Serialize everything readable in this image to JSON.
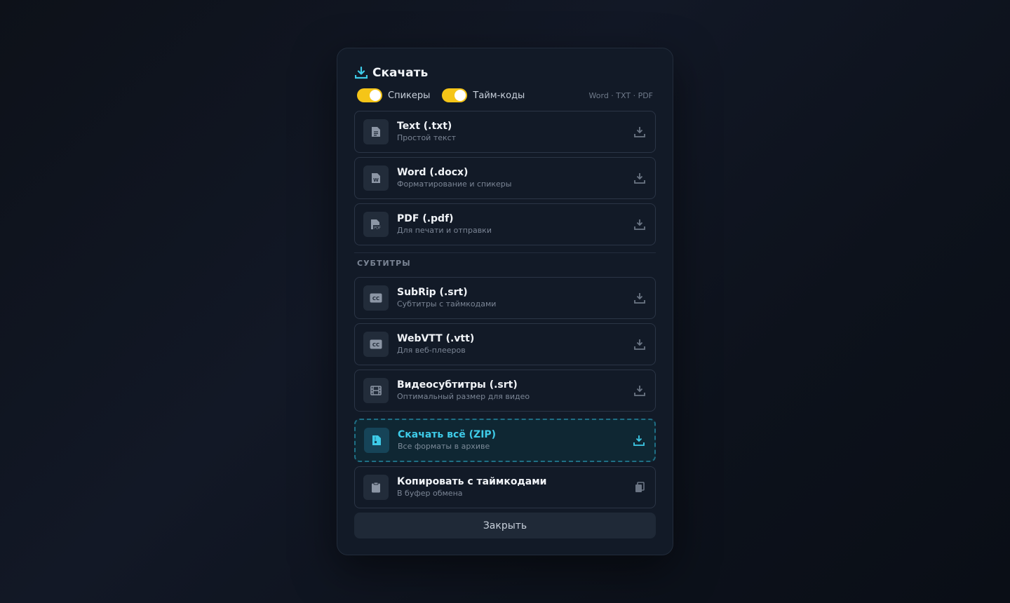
{
  "dialog": {
    "title": "Скачать",
    "toggles": [
      {
        "label": "Спикеры",
        "on": true
      },
      {
        "label": "Тайм-коды",
        "on": true
      }
    ],
    "formats_hint": "Word · TXT · PDF",
    "documents": [
      {
        "name": "Text (.txt)",
        "desc": "Простой текст",
        "icon": "text-file-icon"
      },
      {
        "name": "Word (.docx)",
        "desc": "Форматирование и спикеры",
        "icon": "word-file-icon"
      },
      {
        "name": "PDF (.pdf)",
        "desc": "Для печати и отправки",
        "icon": "pdf-file-icon"
      }
    ],
    "subtitles_section": "СУБТИТРЫ",
    "subtitles": [
      {
        "name": "SubRip (.srt)",
        "desc": "Субтитры с таймкодами",
        "icon": "cc-icon"
      },
      {
        "name": "WebVTT (.vtt)",
        "desc": "Для веб-плееров",
        "icon": "cc-icon"
      },
      {
        "name": "Видеосубтитры (.srt)",
        "desc": "Оптимальный размер для видео",
        "icon": "film-icon"
      }
    ],
    "zip": {
      "name": "Скачать всё (ZIP)",
      "desc": "Все форматы в архиве",
      "icon": "zip-file-icon"
    },
    "copy": {
      "name": "Копировать с таймкодами",
      "desc": "В буфер обмена",
      "icon": "clipboard-icon"
    },
    "close_label": "Закрыть"
  },
  "colors": {
    "accent": "#3ecbe8",
    "toggle": "#f5c518",
    "background": "#0d1119",
    "panel": "#121a27"
  }
}
